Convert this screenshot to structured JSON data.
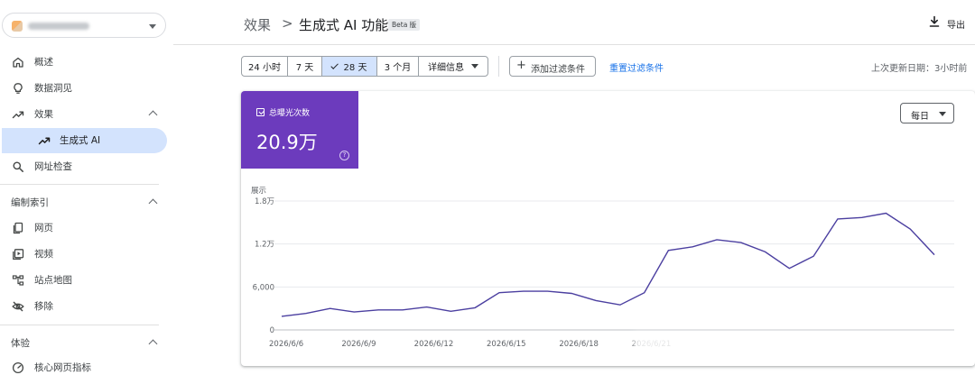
{
  "sidebar": {
    "nav_top": [
      {
        "label": "概述",
        "icon": "home-icon"
      },
      {
        "label": "数据洞见",
        "icon": "lightbulb-icon"
      },
      {
        "label": "效果",
        "icon": "trending-up-icon"
      },
      {
        "label": "生成式 AI",
        "icon": "trending-up-icon",
        "active": true
      },
      {
        "label": "网址检查",
        "icon": "search-icon"
      }
    ],
    "section_index": {
      "label": "编制索引"
    },
    "nav_index": [
      {
        "label": "网页",
        "icon": "pages-icon"
      },
      {
        "label": "视频",
        "icon": "video-icon"
      },
      {
        "label": "站点地图",
        "icon": "sitemap-icon"
      },
      {
        "label": "移除",
        "icon": "removal-icon"
      }
    ],
    "section_experience": {
      "label": "体验"
    },
    "nav_experience": [
      {
        "label": "核心网页指标",
        "icon": "gauge-icon"
      }
    ]
  },
  "header": {
    "breadcrumb_root": "效果",
    "breadcrumb_sep": ">",
    "breadcrumb_current": "生成式 AI 功能",
    "badge": "Beta 版",
    "export_label": "导出"
  },
  "filters": {
    "date_ranges": [
      {
        "label": "24 小时",
        "selected": false
      },
      {
        "label": "7 天",
        "selected": false
      },
      {
        "label": "28 天",
        "selected": true
      },
      {
        "label": "3 个月",
        "selected": false
      }
    ],
    "more_label": "详细信息",
    "add_filter_label": "添加过滤条件",
    "reset_label": "重置过滤条件",
    "last_updated": "上次更新日期：3小时前"
  },
  "card": {
    "metric_label": "总曝光次数",
    "metric_value": "20.9万",
    "granularity": "每日",
    "accent_color": "#6c3bbd"
  },
  "chart_data": {
    "type": "line",
    "title": "",
    "ylabel": "展示",
    "ylim": [
      0,
      18000
    ],
    "yticks": [
      0,
      6000,
      12000,
      18000
    ],
    "ytick_labels": [
      "0",
      "6,000",
      "1.2万",
      "1.8万"
    ],
    "x": [
      "2026/6/6",
      "2026/6/7",
      "2026/6/8",
      "2026/6/9",
      "2026/6/10",
      "2026/6/11",
      "2026/6/12",
      "2026/6/13",
      "2026/6/14",
      "2026/6/15",
      "2026/6/16",
      "2026/6/17",
      "2026/6/18",
      "2026/6/19",
      "2026/6/20",
      "2026/6/21",
      "2026/6/22",
      "2026/6/23",
      "2026/6/24",
      "2026/6/25",
      "2026/6/26",
      "2026/6/27",
      "2026/6/28",
      "2026/6/29",
      "2026/6/30",
      "2026/7/1",
      "2026/7/2",
      "2026/7/3"
    ],
    "xtick_labels": [
      "2026/6/6",
      "2026/6/9",
      "2026/6/12",
      "2026/6/15",
      "2026/6/18",
      "2026/6/21"
    ],
    "series": [
      {
        "color": "#4b3fa0",
        "values": [
          1900,
          2300,
          3000,
          2500,
          2800,
          2800,
          3200,
          2600,
          3100,
          5200,
          5400,
          5400,
          5100,
          4100,
          3500,
          5200,
          11100,
          11600,
          12600,
          12200,
          10900,
          8600,
          10300,
          15500,
          15700,
          16300,
          14100,
          10500
        ]
      }
    ]
  }
}
